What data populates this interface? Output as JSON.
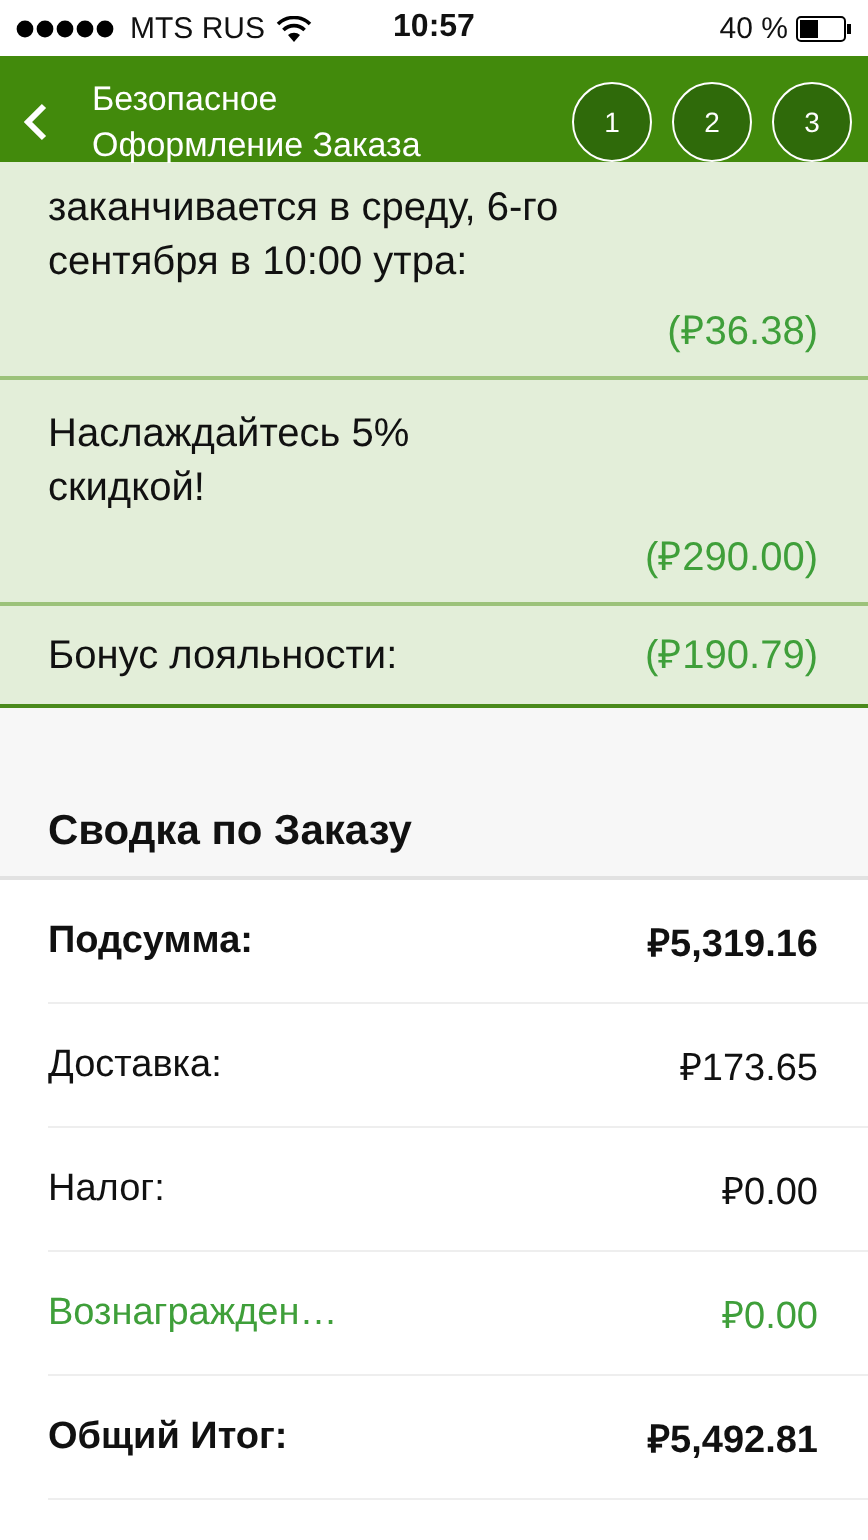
{
  "status_bar": {
    "carrier": "MTS RUS",
    "time": "10:57",
    "battery": "40 %"
  },
  "nav": {
    "title_lines": [
      "Безопасное",
      "Оформление Заказа"
    ],
    "steps": [
      "1",
      "2",
      "3"
    ]
  },
  "discounts": [
    {
      "lines": [
        "заканчивается в среду, 6-го",
        "сентября в 10:00 утра:"
      ],
      "amount": "(₽36.38)",
      "kind": "stacked"
    },
    {
      "lines": [
        "Наслаждайтесь 5%",
        "скидкой!"
      ],
      "amount": "(₽290.00)",
      "kind": "stacked"
    },
    {
      "lines": [
        "Бонус лояльности:"
      ],
      "amount": "(₽190.79)",
      "kind": "inline"
    }
  ],
  "summary": {
    "title": "Сводка по Заказу",
    "rows": [
      {
        "label": "Подсумма:",
        "value": "₽5,319.16",
        "kind": "bold"
      },
      {
        "label": "Доставка:",
        "value": "₽173.65",
        "kind": "normal"
      },
      {
        "label": "Налог:",
        "value": "₽0.00",
        "kind": "normal"
      },
      {
        "label": "Вознагражден…",
        "value": "₽0.00",
        "kind": "reward"
      },
      {
        "label": "Общий Итог:",
        "value": "₽5,492.81",
        "kind": "bold"
      }
    ]
  }
}
